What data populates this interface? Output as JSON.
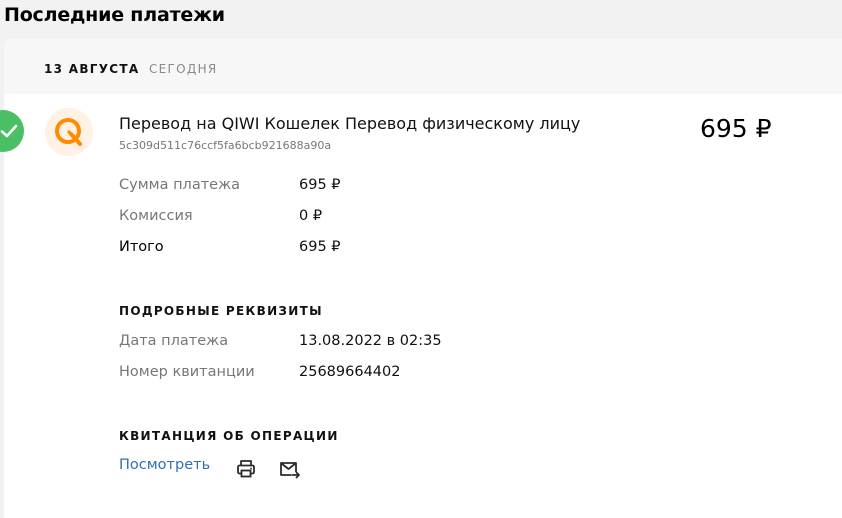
{
  "header": {
    "title": "Последние платежи"
  },
  "date_bar": {
    "date": "13 АВГУСТА",
    "relative": "СЕГОДНЯ"
  },
  "payment": {
    "title": "Перевод на QIWI Кошелек Перевод физическому лицу",
    "transaction_id": "5c309d511c76ccf5fa6bcb921688a90a",
    "amount": "695 ₽",
    "status_icon": "check-icon",
    "provider_icon": "qiwi-logo-icon",
    "colors": {
      "status": "#4bbf63",
      "provider": "#ff8c00"
    },
    "breakdown": [
      {
        "label": "Сумма платежа",
        "value": "695 ₽"
      },
      {
        "label": "Комиссия",
        "value": "0 ₽"
      },
      {
        "label": "Итого",
        "value": "695 ₽"
      }
    ]
  },
  "details": {
    "title": "ПОДРОБНЫЕ РЕКВИЗИТЫ",
    "rows": [
      {
        "label": "Дата платежа",
        "value": "13.08.2022 в 02:35"
      },
      {
        "label": "Номер квитанции",
        "value": "25689664402"
      }
    ]
  },
  "receipt": {
    "title": "КВИТАНЦИЯ ОБ ОПЕРАЦИИ",
    "view_label": "Посмотреть",
    "print_icon": "printer-icon",
    "email_icon": "mail-send-icon"
  }
}
